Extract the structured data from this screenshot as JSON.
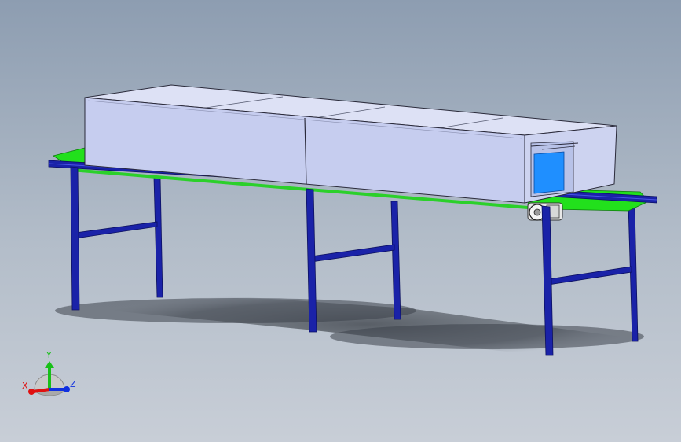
{
  "viewport": {
    "background_top": "#8d9db1",
    "background_bottom": "#c8ced7"
  },
  "model": {
    "frame_color": "#1a22a8",
    "belt_color": "#22e01c",
    "enclosure_color": "#c6cdef",
    "inner_panel_color": "#1f8fff",
    "motor_color": "#e8e8e8"
  },
  "triad": {
    "x_label": "X",
    "y_label": "Y",
    "z_label": "Z",
    "x_color": "#e01010",
    "y_color": "#18c018",
    "z_color": "#1030e0"
  }
}
